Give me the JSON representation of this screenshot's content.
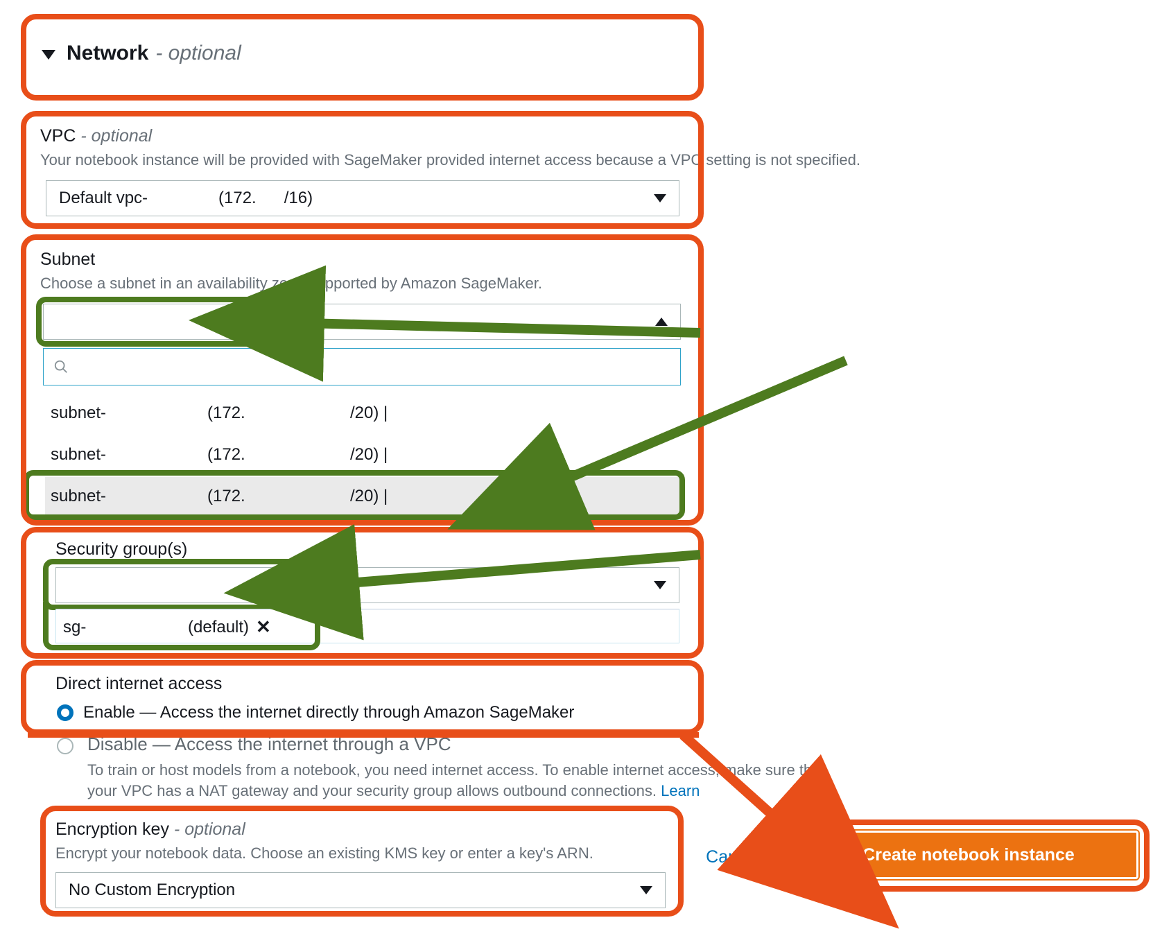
{
  "network": {
    "section_title": "Network",
    "section_optional": "- optional"
  },
  "vpc": {
    "label": "VPC",
    "optional": "- optional",
    "hint": "Your notebook instance will be provided with SageMaker provided internet access because a VPC setting is not specified.",
    "selected_prefix": "Default vpc-",
    "selected_cidr_open": "(172.",
    "selected_cidr_close": "/16)"
  },
  "subnet": {
    "label": "Subnet",
    "hint": "Choose a subnet in an availability zone supported by Amazon SageMaker.",
    "options": [
      {
        "id": "subnet-",
        "cidr_open": "(172.",
        "cidr_close": "/20) |"
      },
      {
        "id": "subnet-",
        "cidr_open": "(172.",
        "cidr_close": "/20) |"
      },
      {
        "id": "subnet-",
        "cidr_open": "(172.",
        "cidr_close": "/20) |"
      }
    ]
  },
  "sg": {
    "label": "Security group(s)",
    "chip_prefix": "sg-",
    "chip_suffix": "(default)"
  },
  "dia": {
    "label": "Direct internet access",
    "enable_text": "Enable — Access the internet directly through Amazon SageMaker",
    "disable_text": "Disable — Access the internet through a VPC",
    "help": "To train or host models from a notebook, you need internet access. To enable internet access, make sure that your VPC has a NAT gateway and your security group allows outbound connections.  ",
    "learn": "Learn"
  },
  "enc": {
    "label": "Encryption key",
    "optional": "- optional",
    "hint": "Encrypt your notebook data. Choose an existing KMS key or enter a key's ARN.",
    "selected": "No Custom Encryption"
  },
  "footer": {
    "cancel": "Cancel",
    "create": "Create notebook instance"
  }
}
